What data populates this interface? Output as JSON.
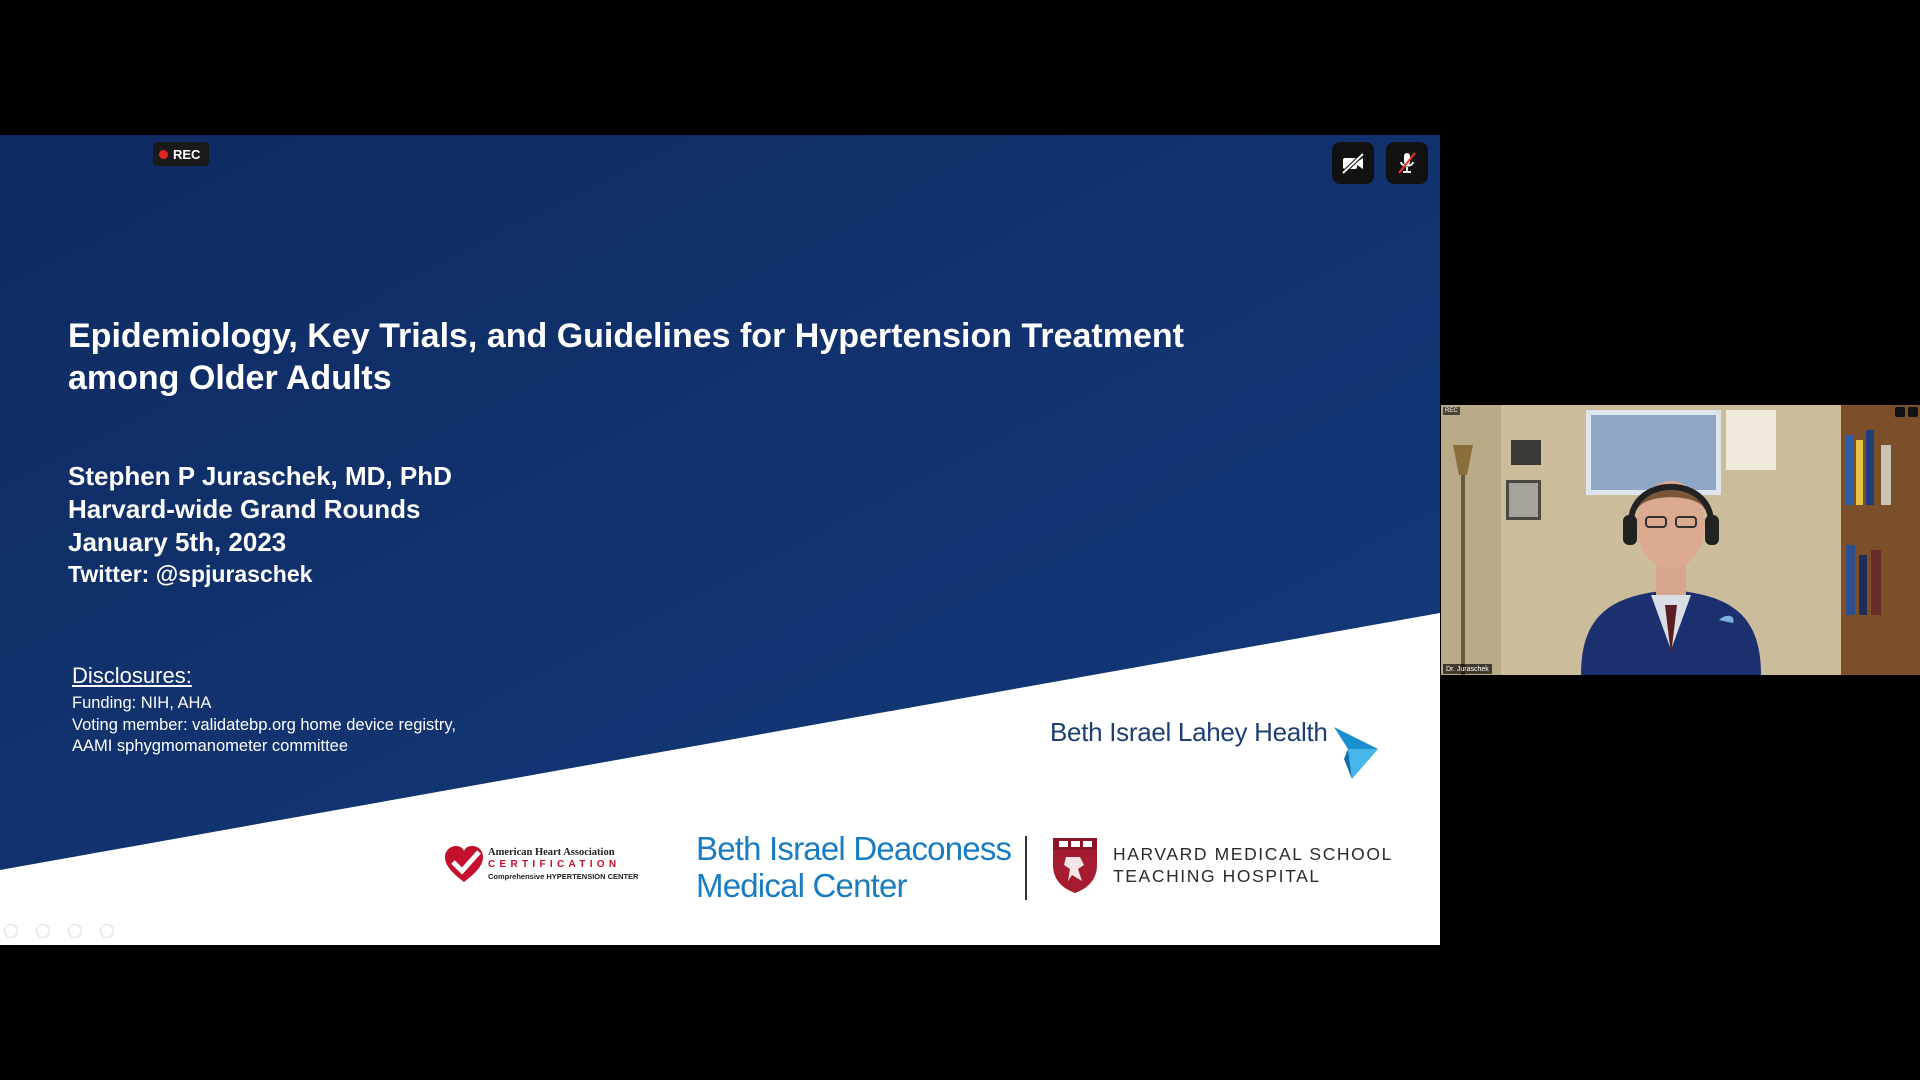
{
  "recording": {
    "label": "REC"
  },
  "slide": {
    "title_lines": [
      "Epidemiology, Key Trials, and Guidelines for Hypertension Treatment",
      "among Older Adults"
    ],
    "speaker": {
      "name": "Stephen P Juraschek, MD, PhD",
      "event": "Harvard-wide Grand Rounds",
      "date": "January 5th, 2023",
      "twitter": "Twitter: @spjuraschek"
    },
    "disclosures": {
      "heading": "Disclosures:",
      "lines": [
        "Funding: NIH, AHA",
        "Voting member: validatebp.org home device registry,",
        "AAMI sphygmomanometer committee"
      ]
    },
    "logos": {
      "blh": "Beth Israel Lahey Health",
      "aha": {
        "line1": "American Heart Association",
        "line2": "CERTIFICATION",
        "line3": "Comprehensive HYPERTENSION CENTER"
      },
      "bidmc": [
        "Beth Israel Deaconess",
        "Medical Center"
      ],
      "hms": [
        "HARVARD MEDICAL SCHOOL",
        "TEACHING HOSPITAL"
      ]
    },
    "colors": {
      "navy": "#11306a",
      "blh_blue": "#2a9fd8",
      "bidmc_blue": "#1a7cc1",
      "aha_red": "#c3102c"
    }
  },
  "controls": {
    "camera_icon": "video-off-icon",
    "mic_icon": "mic-off-icon"
  },
  "webcam": {
    "name": "Dr. Juraschek",
    "top_label": "REC"
  }
}
